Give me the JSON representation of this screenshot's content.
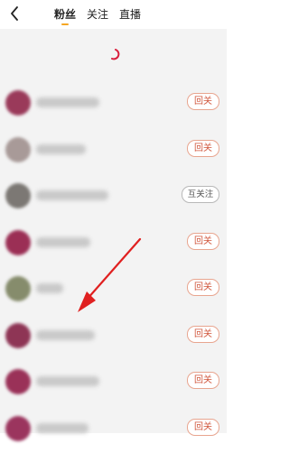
{
  "header": {
    "back_icon": "chevron-left-icon",
    "tabs": [
      {
        "label": "粉丝",
        "active": true
      },
      {
        "label": "关注",
        "active": false
      },
      {
        "label": "直播",
        "active": false
      }
    ]
  },
  "loading": {
    "icon": "loading-spinner-icon"
  },
  "list": {
    "rows": [
      {
        "button_label": "回关",
        "type": "follow-back"
      },
      {
        "button_label": "回关",
        "type": "follow-back"
      },
      {
        "button_label": "互关注",
        "type": "mutual"
      },
      {
        "button_label": "回关",
        "type": "follow-back"
      },
      {
        "button_label": "回关",
        "type": "follow-back"
      },
      {
        "button_label": "回关",
        "type": "follow-back"
      },
      {
        "button_label": "回关",
        "type": "follow-back"
      },
      {
        "button_label": "回关",
        "type": "follow-back"
      }
    ]
  },
  "annotation": {
    "icon": "red-arrow-icon",
    "color": "#e02020"
  },
  "colors": {
    "accent": "#f5a623",
    "button_border": "#e8a58f",
    "button_text": "#d0563c"
  }
}
